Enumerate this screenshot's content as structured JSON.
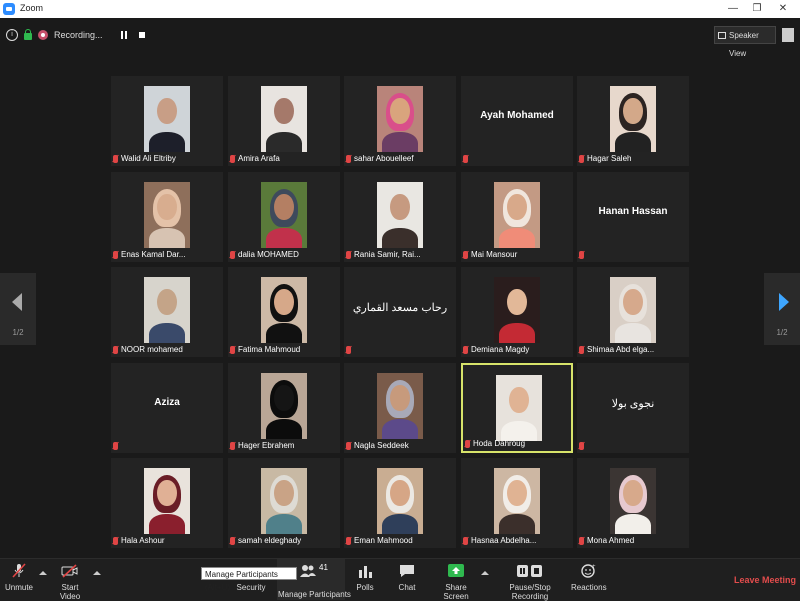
{
  "window": {
    "title": "Zoom",
    "controls": {
      "minimize": "—",
      "maximize": "❐",
      "close": "✕"
    }
  },
  "topbar": {
    "recording_label": "Recording...",
    "speaker_view_label": "Speaker View"
  },
  "pagination": {
    "left_page": "1/2",
    "right_page": "1/2"
  },
  "participants": [
    {
      "name": "Walid Ali Eltriby",
      "video": true,
      "colors": {
        "bg": "#cfd4d8",
        "scarf": "",
        "head": "#c89e86",
        "body": "#1d1f2a"
      }
    },
    {
      "name": "Amira Arafa",
      "video": true,
      "colors": {
        "bg": "#e8e4e0",
        "scarf": "",
        "head": "#a5796a",
        "body": "#2a2a2a"
      }
    },
    {
      "name": "sahar Abouelleef",
      "video": true,
      "colors": {
        "bg": "#b9847a",
        "scarf": "#d94f8a",
        "head": "#d9a47d",
        "body": "#6b3d64"
      }
    },
    {
      "name": "Ayah Mohamed",
      "video": false
    },
    {
      "name": "Hagar Saleh",
      "video": true,
      "colors": {
        "bg": "#e7d8cc",
        "scarf": "#2c2422",
        "head": "#d3a889",
        "body": "#222"
      }
    },
    {
      "name": "Enas Kamal Dar...",
      "video": true,
      "colors": {
        "bg": "#8e6f5b",
        "scarf": "#e4c2a8",
        "head": "#d8ad8f",
        "body": "#d7c3b2"
      }
    },
    {
      "name": "dalia MOHAMED",
      "video": true,
      "colors": {
        "bg": "#5a7a3a",
        "scarf": "#3e4a5c",
        "head": "#b47f63",
        "body": "#c1314b"
      }
    },
    {
      "name": "Rania Samir, Rai...",
      "video": true,
      "colors": {
        "bg": "#e9e7e2",
        "scarf": "",
        "head": "#c69a80",
        "body": "#3a2f2b"
      }
    },
    {
      "name": "Mai Mansour",
      "video": true,
      "colors": {
        "bg": "#c39a84",
        "scarf": "#f0e6dd",
        "head": "#d8a98a",
        "body": "#f08c78"
      }
    },
    {
      "name": "Hanan Hassan",
      "video": false
    },
    {
      "name": "NOOR mohamed",
      "video": true,
      "colors": {
        "bg": "#d7d4cc",
        "scarf": "",
        "head": "#c4a488",
        "body": "#3a4a6a"
      }
    },
    {
      "name": "Fatima Mahmoud",
      "video": true,
      "colors": {
        "bg": "#cdb9a6",
        "scarf": "#111",
        "head": "#d6a889",
        "body": "#111"
      }
    },
    {
      "name": "رحاب مسعد القماري",
      "video": false,
      "arabic": true
    },
    {
      "name": "Demiana Magdy",
      "video": true,
      "colors": {
        "bg": "#2a1d1d",
        "scarf": "",
        "head": "#e2b898",
        "body": "#c42a34"
      }
    },
    {
      "name": "Shimaa Abd elga...",
      "video": true,
      "colors": {
        "bg": "#d9cfc6",
        "scarf": "#e7e1db",
        "head": "#d6a98c",
        "body": "#e8e4e0"
      }
    },
    {
      "name": "Aziza",
      "video": false
    },
    {
      "name": "Hager Ebrahem",
      "video": true,
      "colors": {
        "bg": "#b9a696",
        "scarf": "#0c0c0c",
        "head": "#151515",
        "body": "#0c0c0c"
      }
    },
    {
      "name": "Nagla Seddeek",
      "video": true,
      "colors": {
        "bg": "#7a5b4a",
        "scarf": "#a8a9b8",
        "head": "#c79a7c",
        "body": "#5c4a8a"
      }
    },
    {
      "name": "Hoda Dahroug",
      "video": true,
      "active": true,
      "colors": {
        "bg": "#e7e2dc",
        "scarf": "",
        "head": "#e0b394",
        "body": "#f4f1ec"
      }
    },
    {
      "name": "نجوى بولا",
      "video": false,
      "arabic": true
    },
    {
      "name": "Hala Ashour",
      "video": true,
      "colors": {
        "bg": "#e9e3dc",
        "scarf": "#6a1d26",
        "head": "#e0b095",
        "body": "#8a1f2d"
      }
    },
    {
      "name": "samah eldeghady",
      "video": true,
      "colors": {
        "bg": "#c8b9a4",
        "scarf": "#dedbd4",
        "head": "#c9a386",
        "body": "#50808a"
      }
    },
    {
      "name": "Eman Mahmood",
      "video": true,
      "colors": {
        "bg": "#c9ad92",
        "scarf": "#ebe8e3",
        "head": "#d6a686",
        "body": "#2f3f5a"
      }
    },
    {
      "name": "Hasnaa Abdelha...",
      "video": true,
      "colors": {
        "bg": "#cdb7a3",
        "scarf": "#f1ede8",
        "head": "#e0b393",
        "body": "#3b2f2b"
      }
    },
    {
      "name": "Mona Ahmed",
      "video": true,
      "colors": {
        "bg": "#3b3533",
        "scarf": "#e6c9cf",
        "head": "#d7a98b",
        "body": "#f2efea"
      }
    }
  ],
  "toolbar": {
    "unmute": "Unmute",
    "start_video": "Start Video",
    "security": "Security",
    "manage_participants": "Manage Participants",
    "participant_count": "41",
    "tooltip": "Manage Participants (Alt+U)",
    "polls": "Polls",
    "chat": "Chat",
    "share_screen": "Share Screen",
    "recording": "Pause/Stop Recording",
    "reactions": "Reactions",
    "leave": "Leave Meeting"
  },
  "colors": {
    "accent": "#2d8cff",
    "active_speaker": "#d7e36a",
    "muted": "#e04545",
    "leave": "#e24c4c",
    "share": "#2fb94f"
  }
}
